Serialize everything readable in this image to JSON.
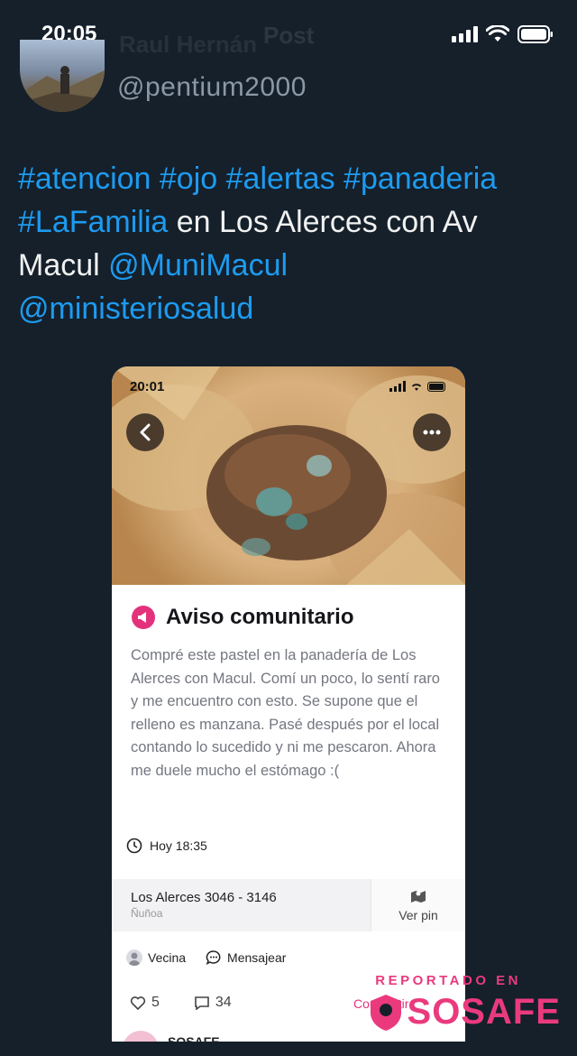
{
  "status_bar": {
    "time": "20:05"
  },
  "header_ghost": {
    "name": "Raul Hernán",
    "title": "Post"
  },
  "tweet": {
    "handle": "@pentium2000",
    "text_parts": [
      {
        "text": "#atencion #ojo #alertas #panaderia",
        "link": true
      },
      {
        "text": "#LaFamilia",
        "link": true
      },
      {
        "text": " en Los Alerces con Av Macul ",
        "link": false
      },
      {
        "text": "@MuniMacul",
        "link": true
      },
      {
        "text": "@ministeriosalud",
        "link": true
      }
    ]
  },
  "embedded_screenshot": {
    "status_time": "20:01",
    "notice_title": "Aviso comunitario",
    "body": "Compré este pastel en la panadería de Los Alerces con Macul. Comí un poco, lo sentí raro y me encuentro con esto. Se supone que el relleno es manzana. Pasé después por el local contando lo sucedido y ni me pescaron. Ahora me duele mucho el estómago :(",
    "time_label": "Hoy 18:35",
    "address_main": "Los Alerces  3046 - 3146",
    "address_sub": "Ñuñoa",
    "map_button": "Ver pin",
    "author_label": "Vecina",
    "message_button": "Mensajear",
    "likes": "5",
    "comments": "34",
    "share_label": "Compartir",
    "next_author": "SOSAFE"
  },
  "watermark": {
    "top": "REPORTADO EN",
    "brand": "SOSAFE"
  },
  "colors": {
    "background": "#15202b",
    "link": "#1d9bf0",
    "accent": "#e3327b"
  }
}
